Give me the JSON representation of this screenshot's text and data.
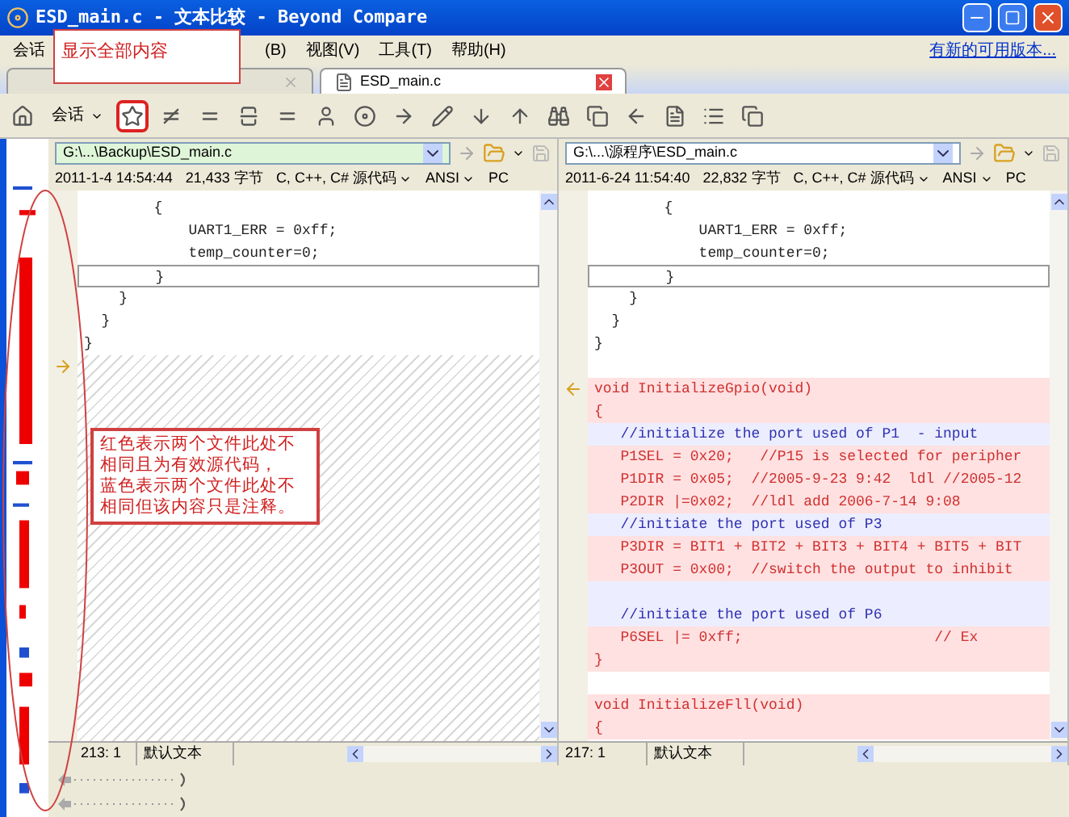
{
  "window": {
    "title": "ESD_main.c - 文本比较 - Beyond Compare"
  },
  "menu": {
    "items": [
      "会话",
      "(B)",
      "视图(V)",
      "工具(T)",
      "帮助(H)"
    ],
    "update_link": "有新的可用版本..."
  },
  "callout_top": {
    "text": "显示全部内容"
  },
  "tabs": [
    {
      "selected": false
    },
    {
      "label": "ESD_main.c",
      "selected": true
    }
  ],
  "toolbar": {
    "session_label": "会话",
    "show_all_selected": true
  },
  "panes": [
    {
      "path": "G:\\...\\Backup\\ESD_main.c",
      "info": [
        "2011-1-4 14:54:44",
        "21,433 字节",
        "C, C++, C# 源代码",
        "ANSI",
        "PC"
      ],
      "lines": [
        {
          "kind": "same",
          "text": "        {"
        },
        {
          "kind": "same",
          "text": "            UART1_ERR = 0xff;"
        },
        {
          "kind": "same",
          "text": "            temp_counter=0;"
        },
        {
          "kind": "same",
          "text": "        }",
          "current": true
        },
        {
          "kind": "same",
          "text": "    }"
        },
        {
          "kind": "same",
          "text": "  }"
        },
        {
          "kind": "same",
          "text": "}"
        },
        {
          "kind": "gap",
          "marker": true
        }
      ],
      "status": {
        "position": "213: 1",
        "format": "默认文本"
      }
    },
    {
      "path": "G:\\...\\源程序\\ESD_main.c",
      "info": [
        "2011-6-24 11:54:40",
        "22,832 字节",
        "C, C++, C# 源代码",
        "ANSI",
        "PC"
      ],
      "lines": [
        {
          "kind": "same",
          "text": "        {"
        },
        {
          "kind": "same",
          "text": "            UART1_ERR = 0xff;"
        },
        {
          "kind": "same",
          "text": "            temp_counter=0;"
        },
        {
          "kind": "same",
          "text": "        }",
          "current": true
        },
        {
          "kind": "same",
          "text": "    }"
        },
        {
          "kind": "same",
          "text": "  }"
        },
        {
          "kind": "same",
          "text": "}"
        },
        {
          "kind": "blank"
        },
        {
          "kind": "diff",
          "text": "void InitializeGpio(void)",
          "marker": true
        },
        {
          "kind": "diff",
          "text": "{"
        },
        {
          "kind": "comment",
          "text": "   //initialize the port used of P1  - input"
        },
        {
          "kind": "diff",
          "text": "   P1SEL = 0x20;   //P15 is selected for peripher"
        },
        {
          "kind": "diff",
          "text": "   P1DIR = 0x05;  //2005-9-23 9:42  ldl //2005-12"
        },
        {
          "kind": "diff",
          "text": "   P2DIR |=0x02;  //ldl add 2006-7-14 9:08"
        },
        {
          "kind": "comment",
          "text": "   //initiate the port used of P3"
        },
        {
          "kind": "diff",
          "text": "   P3DIR = BIT1 + BIT2 + BIT3 + BIT4 + BIT5 + BIT"
        },
        {
          "kind": "diff",
          "text": "   P3OUT = 0x00;  //switch the output to inhibit"
        },
        {
          "kind": "comment"
        },
        {
          "kind": "comment",
          "text": "   //initiate the port used of P6"
        },
        {
          "kind": "diff",
          "text": "   P6SEL |= 0xff;                      // Ex"
        },
        {
          "kind": "diff",
          "text": "}"
        },
        {
          "kind": "blank"
        },
        {
          "kind": "diff",
          "text": "void InitializeFll(void)"
        },
        {
          "kind": "diff",
          "text": "{"
        }
      ],
      "status": {
        "position": "217: 1",
        "format": "默认文本"
      }
    }
  ],
  "callout_bottom": {
    "lines": [
      "红色表示两个文件此处不相同且为有效源代码，",
      "蓝色表示两个文件此处不相同但该内容只是注释。"
    ]
  }
}
